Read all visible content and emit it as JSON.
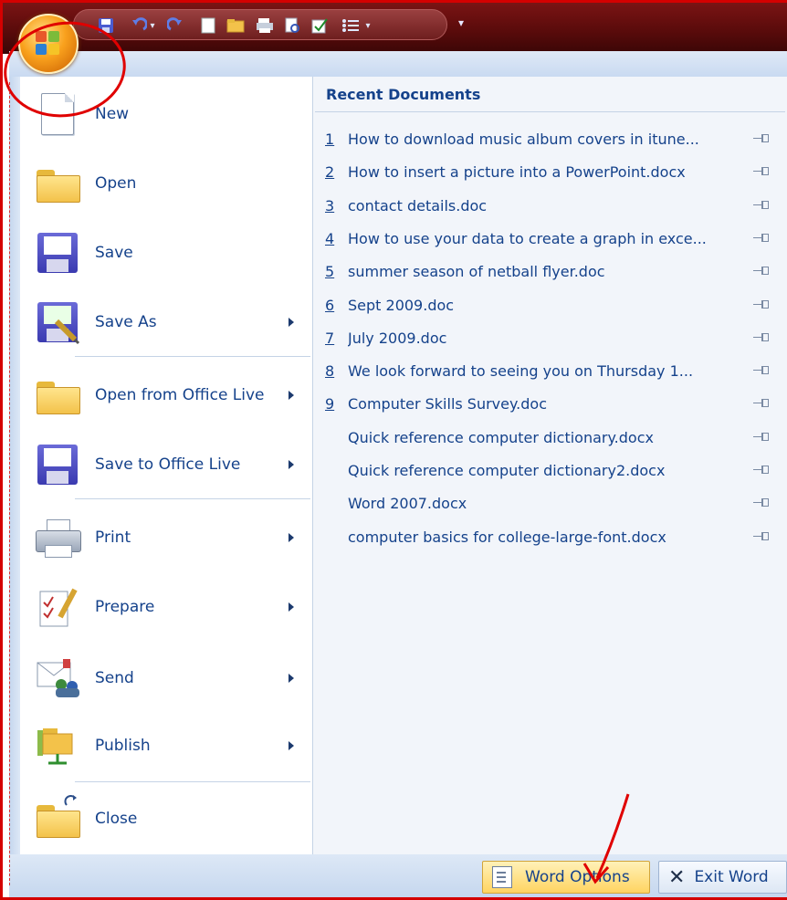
{
  "quick_access": {
    "icons": [
      "save-icon",
      "undo-icon",
      "undo-dropdown-icon",
      "redo-icon",
      "new-doc-icon",
      "open-icon",
      "print-preview-icon",
      "print-icon",
      "spelling-icon",
      "bullets-icon",
      "customize-qat-icon"
    ]
  },
  "office_button": {
    "icon": "office-logo-icon"
  },
  "menu": {
    "items": [
      {
        "label": "New",
        "icon": "new-document-icon"
      },
      {
        "label": "Open",
        "icon": "open-folder-icon"
      },
      {
        "label": "Save",
        "icon": "save-floppy-icon"
      },
      {
        "label": "Save As",
        "icon": "save-as-icon",
        "submenu": true
      },
      {
        "label": "Open from Office Live",
        "icon": "office-live-open-icon",
        "submenu": true
      },
      {
        "label": "Save to Office Live",
        "icon": "office-live-save-icon",
        "submenu": true
      },
      {
        "label": "Print",
        "icon": "print-icon",
        "submenu": true
      },
      {
        "label": "Prepare",
        "icon": "prepare-icon",
        "submenu": true
      },
      {
        "label": "Send",
        "icon": "send-icon",
        "submenu": true
      },
      {
        "label": "Publish",
        "icon": "publish-icon",
        "submenu": true
      },
      {
        "label": "Close",
        "icon": "close-folder-icon"
      }
    ]
  },
  "recent": {
    "title": "Recent Documents",
    "documents": [
      {
        "num": "1",
        "name": "How to download music album covers in itune..."
      },
      {
        "num": "2",
        "name": "How to insert a picture into a PowerPoint.docx"
      },
      {
        "num": "3",
        "name": "contact details.doc"
      },
      {
        "num": "4",
        "name": "How to use your data to create a graph in exce..."
      },
      {
        "num": "5",
        "name": "summer season of netball flyer.doc"
      },
      {
        "num": "6",
        "name": "Sept 2009.doc"
      },
      {
        "num": "7",
        "name": "July 2009.doc"
      },
      {
        "num": "8",
        "name": "We look forward to seeing you on Thursday 1..."
      },
      {
        "num": "9",
        "name": "Computer Skills Survey.doc"
      },
      {
        "num": "",
        "name": "Quick reference computer dictionary.docx"
      },
      {
        "num": "",
        "name": "Quick reference computer dictionary2.docx"
      },
      {
        "num": "",
        "name": "Word 2007.docx"
      },
      {
        "num": "",
        "name": "computer basics for college-large-font.docx"
      }
    ]
  },
  "footer": {
    "options_label": "Word Options",
    "exit_label": "Exit Word"
  },
  "colors": {
    "title_bar": "#6a1010",
    "menu_text": "#15428b",
    "highlight_button": "#ffd461",
    "annotation": "#e00000"
  }
}
